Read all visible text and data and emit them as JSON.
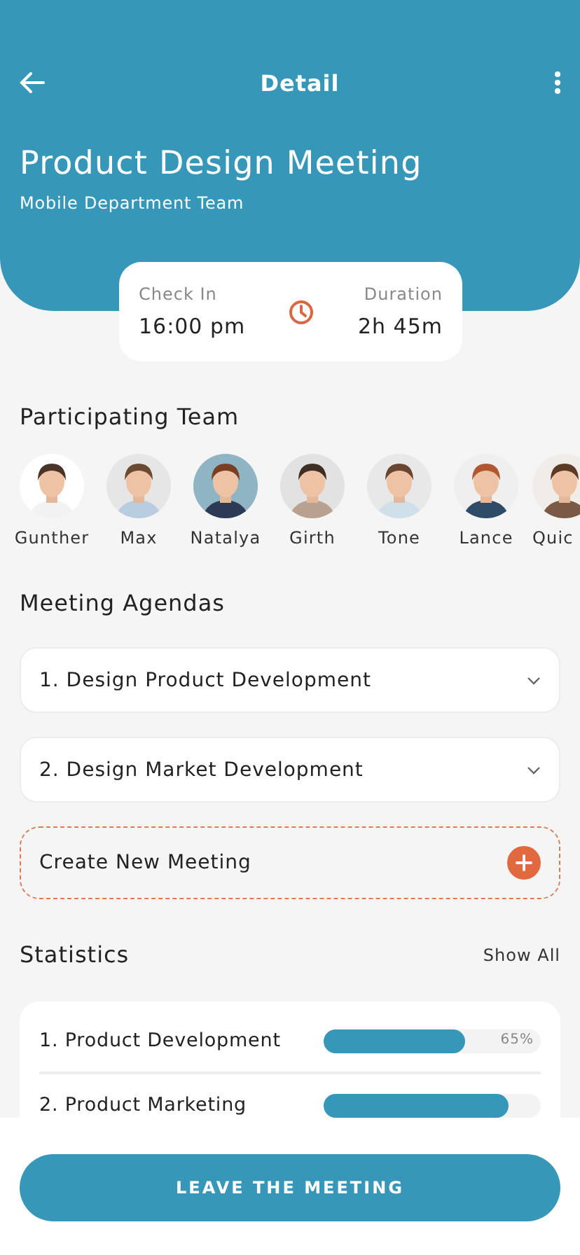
{
  "header": {
    "title": "Detail",
    "meeting_title": "Product Design Meeting",
    "subtitle": "Mobile Department Team"
  },
  "time_card": {
    "check_in_label": "Check In",
    "check_in": "16:00 pm",
    "duration_label": "Duration",
    "duration": "2h 45m"
  },
  "team": {
    "title": "Participating Team",
    "members": [
      {
        "name": "Gunther",
        "kind": "picture"
      },
      {
        "name": "Max",
        "kind": "picture"
      },
      {
        "name": "Natalya",
        "kind": "picture"
      },
      {
        "name": "Girth",
        "kind": "picture"
      },
      {
        "name": "Tone",
        "kind": "picture"
      },
      {
        "name": "Lance",
        "kind": "picture"
      },
      {
        "name": "Quic",
        "kind": "picture"
      }
    ]
  },
  "agendas": {
    "title": "Meeting Agendas",
    "items": [
      {
        "label": "1. Design Product Development",
        "expanded": false
      },
      {
        "label": "2. Design Market Development",
        "expanded": false
      }
    ],
    "create": "Create New Meeting"
  },
  "statistics": {
    "title": "Statistics",
    "show_all": "Show All",
    "rows": [
      {
        "label": "1. Product Development",
        "level": 0.65,
        "reading": "65%"
      },
      {
        "label": "2. Product Marketing",
        "level": 0.85
      }
    ]
  },
  "footer": {
    "button": "LEAVE THE MEETING"
  }
}
